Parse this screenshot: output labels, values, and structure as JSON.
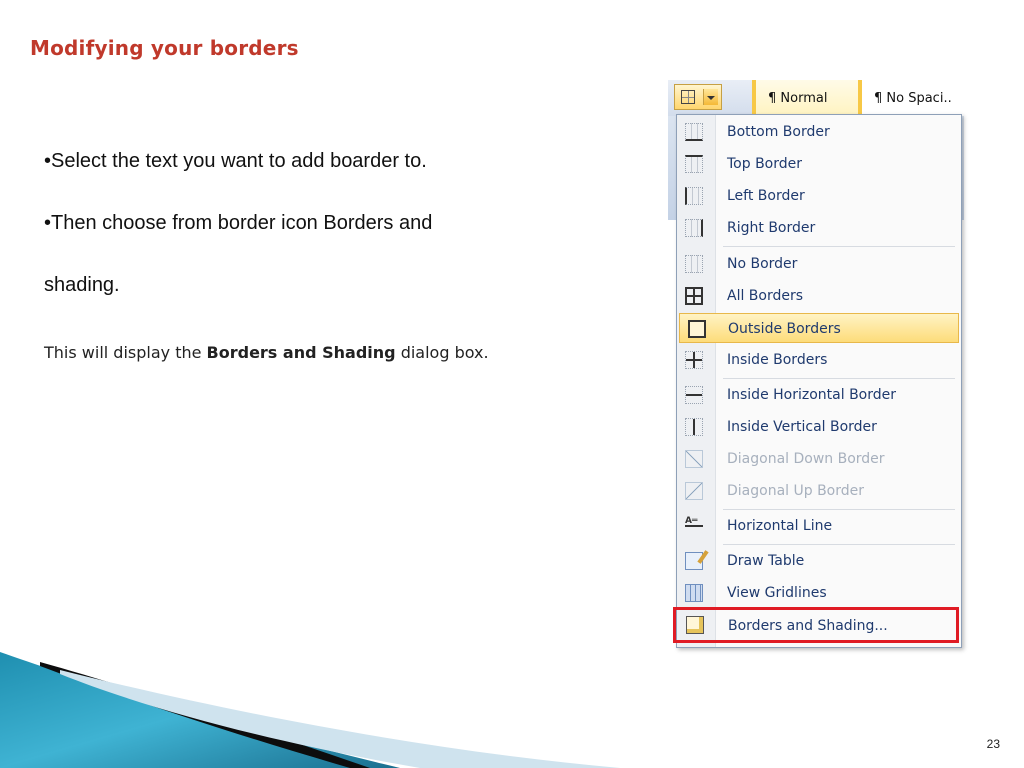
{
  "slide": {
    "title": "Modifying your borders",
    "bullets": [
      "•Select the text you want to add boarder to.",
      "•Then choose from border icon Borders and",
      "shading."
    ],
    "note_prefix": "This will display the ",
    "note_bold": "Borders and Shading",
    "note_suffix": " dialog box.",
    "page_number": "23"
  },
  "ribbon": {
    "styles": [
      "¶ Normal",
      "¶ No Spaci.."
    ]
  },
  "menu": {
    "items": [
      {
        "label": "Bottom Border",
        "icon": "bottom-border-icon",
        "state": "enabled"
      },
      {
        "label": "Top Border",
        "icon": "top-border-icon",
        "state": "enabled"
      },
      {
        "label": "Left Border",
        "icon": "left-border-icon",
        "state": "enabled"
      },
      {
        "label": "Right Border",
        "icon": "right-border-icon",
        "state": "enabled"
      },
      {
        "label": "No Border",
        "icon": "no-border-icon",
        "state": "enabled"
      },
      {
        "label": "All Borders",
        "icon": "all-borders-icon",
        "state": "enabled"
      },
      {
        "label": "Outside Borders",
        "icon": "outside-borders-icon",
        "state": "highlighted"
      },
      {
        "label": "Inside Borders",
        "icon": "inside-borders-icon",
        "state": "enabled"
      },
      {
        "label": "Inside Horizontal Border",
        "icon": "inside-horizontal-border-icon",
        "state": "enabled"
      },
      {
        "label": "Inside Vertical Border",
        "icon": "inside-vertical-border-icon",
        "state": "enabled"
      },
      {
        "label": "Diagonal Down Border",
        "icon": "diagonal-down-border-icon",
        "state": "disabled"
      },
      {
        "label": "Diagonal Up Border",
        "icon": "diagonal-up-border-icon",
        "state": "disabled"
      },
      {
        "label": "Horizontal Line",
        "icon": "horizontal-line-icon",
        "state": "enabled"
      },
      {
        "label": "Draw Table",
        "icon": "draw-table-icon",
        "state": "enabled"
      },
      {
        "label": "View Gridlines",
        "icon": "view-gridlines-icon",
        "state": "enabled"
      },
      {
        "label": "Borders and Shading...",
        "icon": "borders-and-shading-icon",
        "state": "outlined-red"
      }
    ]
  },
  "colors": {
    "title": "#c0392b",
    "menu_text": "#1f3a6e",
    "highlight": "#fddc7a",
    "callout_frame": "#e01b24"
  }
}
